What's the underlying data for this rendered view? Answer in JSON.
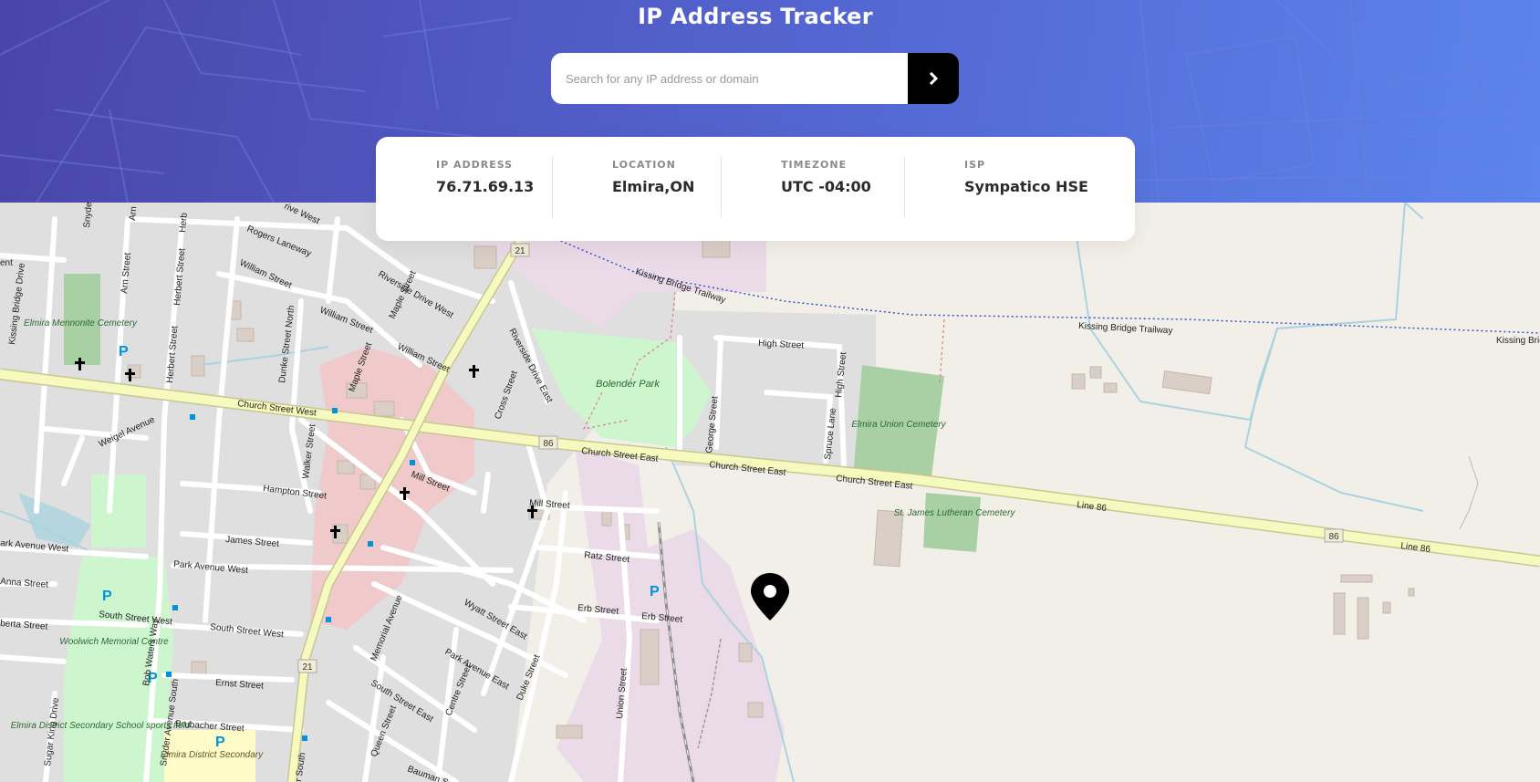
{
  "header": {
    "title": "IP Address Tracker",
    "search": {
      "placeholder": "Search for any IP address or domain",
      "value": "",
      "submit_icon": "chevron-right-icon"
    }
  },
  "info": {
    "items": [
      {
        "label": "IP ADDRESS",
        "value": "76.71.69.13"
      },
      {
        "label": "LOCATION",
        "value": "Elmira,ON"
      },
      {
        "label": "TIMEZONE",
        "value": "UTC -04:00"
      },
      {
        "label": "ISP",
        "value": "Sympatico HSE"
      }
    ]
  },
  "map": {
    "marker_icon": "location-pin-icon",
    "labels": {
      "church_street_west": "Church Street West",
      "church_street_east_1": "Church Street East",
      "church_street_east_2": "Church Street East",
      "church_street_east_3": "Church Street East",
      "line86_1": "Line 86",
      "line86_2": "Line 86",
      "route86_shield_1": "86",
      "route86_shield_2": "86",
      "route21_shield_1": "21",
      "route21_shield_2": "21",
      "high_street_1": "High Street",
      "high_street_2": "High Street",
      "george_street": "George Street",
      "spruce_lane": "Spruce Lane",
      "kissing_bridge_trailway_1": "Kissing Bridge Trailway",
      "kissing_bridge_trailway_2": "Kissing Bridge Trailway",
      "kissing_bridge_trailway_3": "Kissing Brid",
      "bolender_park": "Bolender Park",
      "elmira_union_cemetery": "Elmira Union Cemetery",
      "st_james_cemetery": "St. James Lutheran Cemetery",
      "elmira_mennonite_cemetery": "Elmira Mennonite Cemetery",
      "woolwich_memorial_centre": "Woolwich Memorial Centre",
      "elmira_district_secondary_sports_field": "Elmira District Secondary School sports field",
      "elmira_district_secondary": "Elmira District Secondary",
      "riverside_drive_west": "Riverside Drive West",
      "riverside_drive_east": "Riverside Drive East",
      "william_street_1": "William Street",
      "william_street_2": "William Street",
      "william_street_3": "William Street",
      "maple_street_1": "Maple Street",
      "maple_street_2": "Maple Street",
      "dunke_street_north": "Dunke Street North",
      "herbert_street_1": "Herbert Street",
      "herbert_street_2": "Herbert Street",
      "arn_street": "Arn Street",
      "kissing_bridge_drive": "Kissing Bridge Drive",
      "weigel_avenue": "Weigel Avenue",
      "rogers_laneway": "Rogers Laneway",
      "cross_street": "Cross Street",
      "mill_street_1": "Mill Street",
      "mill_street_2": "Mill Street",
      "hampton_street": "Hampton Street",
      "walker_street": "Walker Street",
      "james_street": "James Street",
      "park_avenue_west_1": "Park Avenue West",
      "park_avenue_west_2": "ark Avenue West",
      "ratz_street": "Ratz Street",
      "wyatt_street_east": "Wyatt Street East",
      "erb_street_1": "Erb Street",
      "erb_street_2": "Erb Street",
      "park_avenue_east": "Park Avenue East",
      "south_street_west_1": "South Street West",
      "south_street_west_2": "South Street West",
      "memorial_avenue": "Memorial Avenue",
      "south_street_east": "South Street East",
      "ernst_street": "Ernst Street",
      "brubacher_street": "Brubacher Street",
      "bob_waters_way": "Bob Waters Way",
      "snyder_avenue_south": "Snyder Avenue South",
      "sugar_king_drive": "Sugar King Drive",
      "queen_street": "Queen Street",
      "centre_street": "Centre Street",
      "duke_street": "Duke Street",
      "union_street": "Union Street",
      "bauman_street": "Bauman S",
      "arthur_south": "r South",
      "anna_street": "Anna Street",
      "alberta_street": "berta Street",
      "snyder_trunc": "Snyde",
      "drive_west_trunc": "rive West",
      "arn_trunc": "Arn",
      "herb_trunc": "Herb",
      "ent_trunc": "ent"
    }
  }
}
